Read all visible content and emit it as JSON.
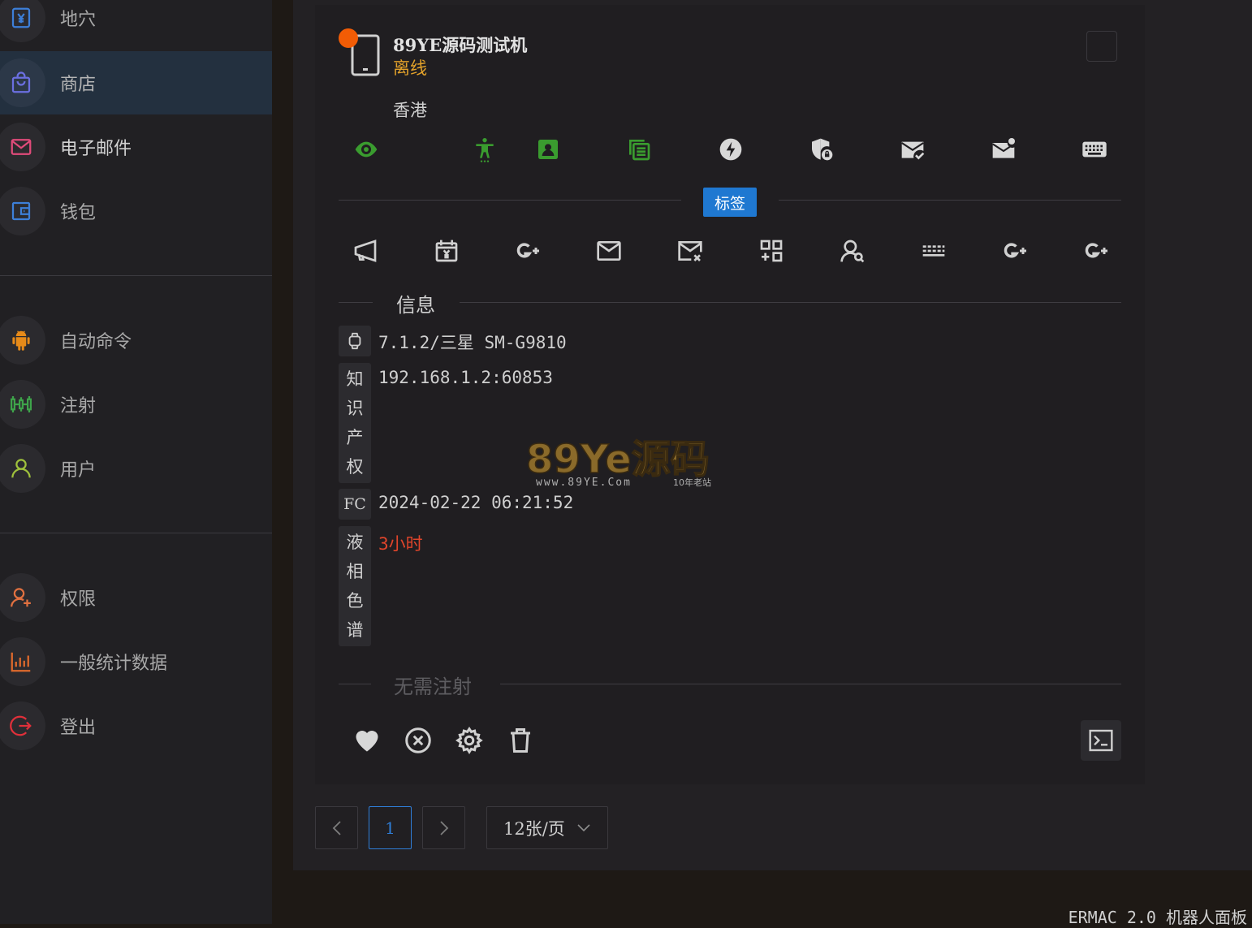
{
  "sidebar": {
    "items": [
      {
        "label": "地穴",
        "icon": "yen-document-icon",
        "color": "#3d7fd8"
      },
      {
        "label": "商店",
        "icon": "shopping-bag-icon",
        "color": "#6b6fe0"
      },
      {
        "label": "电子邮件",
        "icon": "mail-icon",
        "color": "#e04b7a"
      },
      {
        "label": "钱包",
        "icon": "wallet-icon",
        "color": "#3d7fd8"
      },
      {
        "label": "自动命令",
        "icon": "android-icon",
        "color": "#e68a19"
      },
      {
        "label": "注射",
        "icon": "syringe-bars-icon",
        "color": "#3ea34a"
      },
      {
        "label": "用户",
        "icon": "user-icon",
        "color": "#9fc13c"
      },
      {
        "label": "权限",
        "icon": "user-plus-icon",
        "color": "#e07040"
      },
      {
        "label": "一般统计数据",
        "icon": "bar-chart-icon",
        "color": "#e06a2c"
      },
      {
        "label": "登出",
        "icon": "logout-icon",
        "color": "#e0303a"
      }
    ]
  },
  "device": {
    "name": "89YE源码测试机",
    "status": "离线",
    "country": "香港",
    "tags_label": "标签",
    "info_title": "信息",
    "injections_title": "无需注射",
    "status_dot_color": "#f25c05"
  },
  "info": [
    {
      "badge": "android-watch-icon",
      "value": "7.1.2/三星 SM-G9810"
    },
    {
      "badge_chars": [
        "知",
        "识",
        "产",
        "权"
      ],
      "value": "192.168.1.2:60853"
    },
    {
      "badge_text": "FC",
      "value": "2024-02-22 06:21:52"
    },
    {
      "badge_chars": [
        "液",
        "相",
        "色",
        "谱"
      ],
      "value": "3小时",
      "value_color": "#e0452b"
    }
  ],
  "watermark": {
    "main": "89Ye源码",
    "url": "www.89YE.Com",
    "tagline": "10年老站"
  },
  "pagination": {
    "current": "1",
    "page_size": "12张/页"
  },
  "footer": "ERMAC 2.0 机器人面板",
  "colors": {
    "green": "#3a9c2f",
    "tag_blue": "#1f78d1",
    "offline": "#e3a22a"
  }
}
